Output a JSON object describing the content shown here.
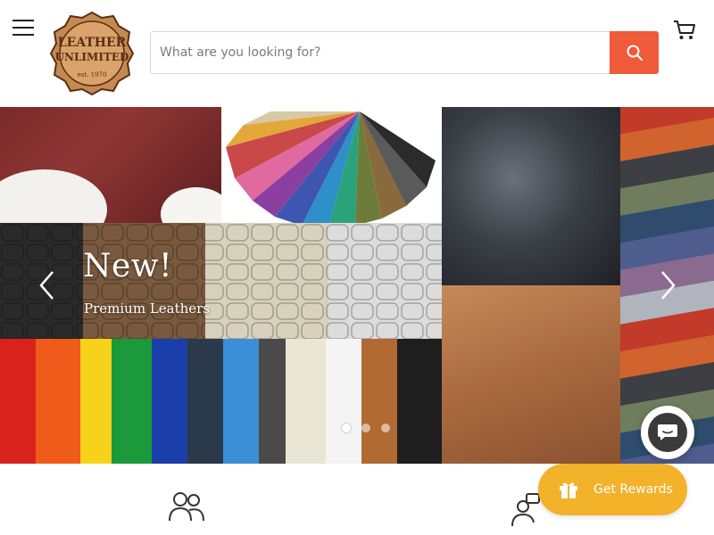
{
  "header": {
    "logo": {
      "line1": "LEATHER",
      "line2": "UNLIMITED",
      "line3": "est. 1970"
    },
    "search": {
      "placeholder": "What are you looking for?",
      "value": ""
    },
    "icons": {
      "menu": "hamburger-icon",
      "search": "search-icon",
      "cart": "cart-icon"
    }
  },
  "hero": {
    "title": "New!",
    "subtitle": "Premium Leathers",
    "slides_count": 3,
    "active_slide": 1
  },
  "rewards": {
    "label": "Get Rewards",
    "icon": "gift-icon"
  },
  "features": {
    "icons": [
      "users-icon",
      "support-agent-icon"
    ]
  },
  "colors": {
    "accent": "#ef5a3b",
    "rewards": "#f2b22a",
    "logo_brown": "#5a2e12"
  }
}
